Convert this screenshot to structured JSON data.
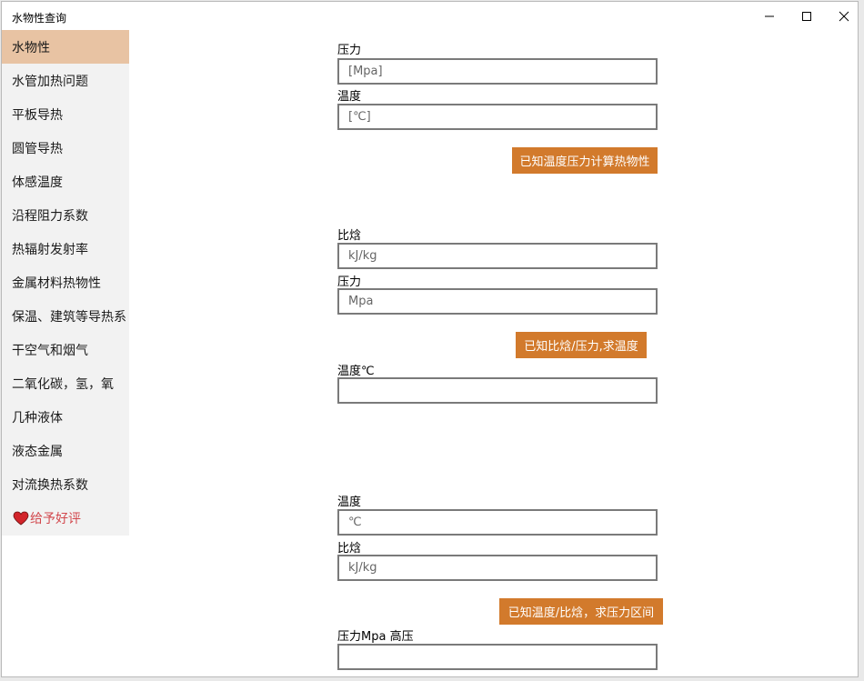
{
  "window": {
    "title": "水物性查询"
  },
  "sidebar": {
    "items": [
      {
        "label": "水物性"
      },
      {
        "label": "水管加热问题"
      },
      {
        "label": "平板导热"
      },
      {
        "label": "圆管导热"
      },
      {
        "label": "体感温度"
      },
      {
        "label": "沿程阻力系数"
      },
      {
        "label": "热辐射发射率"
      },
      {
        "label": "金属材料热物性"
      },
      {
        "label": "保温、建筑等导热系"
      },
      {
        "label": "干空气和烟气"
      },
      {
        "label": "二氧化碳，氢，氧"
      },
      {
        "label": "几种液体"
      },
      {
        "label": "液态金属"
      },
      {
        "label": "对流换热系数"
      }
    ],
    "rate": {
      "label": "给予好评",
      "icon": "heart-icon",
      "color": "#d2484d"
    },
    "selected_color": "#e8c3a3"
  },
  "section1": {
    "pressure_label": "压力",
    "pressure_placeholder": "[Mpa]",
    "temperature_label": "温度",
    "temperature_placeholder": "[℃]",
    "button_label": "已知温度压力计算热物性"
  },
  "section2": {
    "enthalpy_label": "比焓",
    "enthalpy_placeholder": "kJ/kg",
    "pressure_label": "压力",
    "pressure_placeholder": "Mpa",
    "button_label": "已知比焓/压力,求温度",
    "result_label": "温度℃",
    "result_value": ""
  },
  "section3": {
    "temperature_label": "温度",
    "temperature_placeholder": "℃",
    "enthalpy_label": "比焓",
    "enthalpy_placeholder": "kJ/kg",
    "button_label": "已知温度/比焓，求压力区间",
    "result_label": "压力Mpa 高压",
    "result_value": ""
  },
  "colors": {
    "accent_button": "#d27a2c",
    "input_border": "#7a7a7a"
  }
}
